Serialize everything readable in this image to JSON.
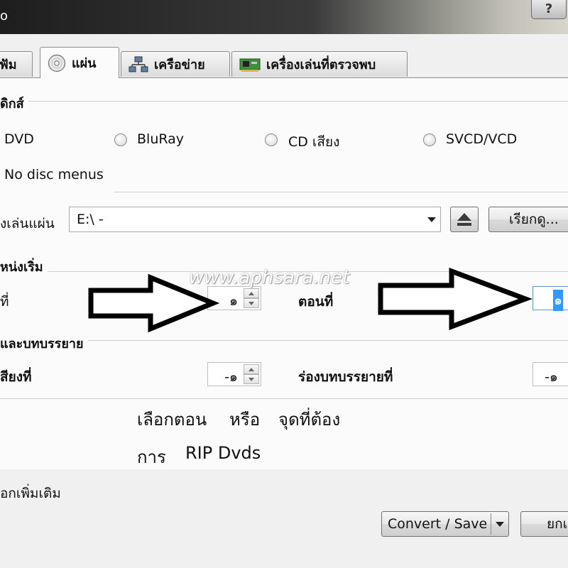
{
  "window": {
    "title": "o",
    "help_label": "?"
  },
  "tabs": [
    {
      "label": "ฟัม",
      "icon": "file-icon"
    },
    {
      "label": "แผ่น",
      "icon": "disc-icon"
    },
    {
      "label": "เครือข่าย",
      "icon": "network-icon"
    },
    {
      "label": "เครื่องเล่นที่ตรวจพบ",
      "icon": "capture-card-icon"
    }
  ],
  "disc_selection": {
    "legend": "ดิกส์",
    "options": [
      "DVD",
      "BluRay",
      "CD เสียง",
      "SVCD/VCD"
    ],
    "no_menus_label": "No disc menus",
    "device_label": "งเล่นแผ่น",
    "device_value": "E:\\ -",
    "browse_label": "เรียกดู..."
  },
  "start_position": {
    "legend": "หน่งเริ่ม",
    "title_label": "ที่",
    "title_value": "๑",
    "chapter_label": "ตอนที่",
    "chapter_value": "๑"
  },
  "audio_subtitles": {
    "legend": "และบทบรรยาย",
    "audio_label": "สียงที่",
    "audio_value": "-๑",
    "subtitle_label": "ร่องบทบรรยายที่",
    "subtitle_value": "-๑"
  },
  "annotation": {
    "line1": [
      "เลือกตอน",
      "หรือ",
      "จุดที่ต้อง"
    ],
    "line2": [
      "การ",
      "RIP Dvds"
    ]
  },
  "watermark": "www.aphsara.net",
  "footer": {
    "more_options": "อกเพิ่มเติม",
    "convert_label": "Convert / Save",
    "cancel_label": "ยกเ"
  }
}
